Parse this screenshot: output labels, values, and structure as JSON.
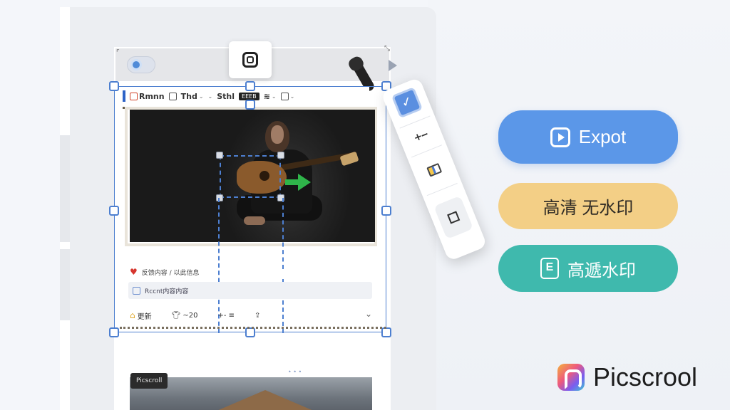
{
  "toolbar": {
    "items": [
      "Rmnn",
      "Thd",
      "Sthl"
    ],
    "badge": "EEEB"
  },
  "content": {
    "row1_text": "反馈内容 / 以此信息",
    "row2_text": "Rccnt内容内容",
    "row3_items": [
      {
        "icon": "home-icon",
        "label": "更新"
      },
      {
        "icon": "shirt-icon",
        "label": "~20"
      },
      {
        "icon": "stepper-icon",
        "label": "+- ≡"
      },
      {
        "icon": "share-icon",
        "label": ""
      }
    ],
    "lower_tag": "Picscroll",
    "lower_dots": "• • •"
  },
  "actions": {
    "export_label": "Expot",
    "hd_label": "高清 无水印",
    "remove_label": "高遞水印"
  },
  "brand": {
    "name": "Picscrool"
  },
  "colors": {
    "accent_blue": "#5b97e8",
    "hd_yellow": "#f3cf86",
    "remove_teal": "#3fb9ad",
    "selection_blue": "#4d7fd0"
  }
}
